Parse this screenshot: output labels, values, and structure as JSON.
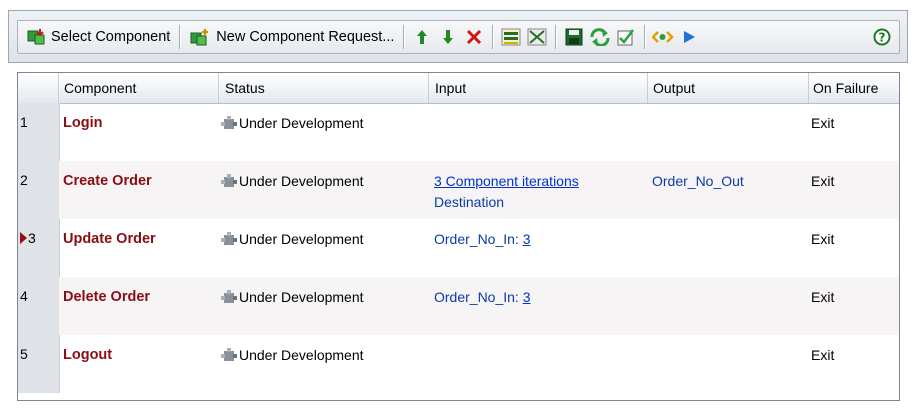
{
  "toolbar": {
    "select_component_label": "Select Component",
    "new_component_request_label": "New Component Request..."
  },
  "columns": [
    "Component",
    "Status",
    "Input",
    "Output",
    "On Failure"
  ],
  "rows": [
    {
      "num": "1",
      "component": "Login",
      "status": "Under Development",
      "input_link": "",
      "input_extra": "",
      "input_prefix": "",
      "input_value": "",
      "output": "",
      "on_failure": "Exit"
    },
    {
      "num": "2",
      "component": "Create Order",
      "status": "Under Development",
      "input_link": "3 Component iterations",
      "input_extra": "Destination",
      "input_prefix": "",
      "input_value": "",
      "output": "Order_No_Out",
      "on_failure": "Exit"
    },
    {
      "num": "3",
      "component": "Update Order",
      "status": "Under Development",
      "input_link": "",
      "input_extra": "",
      "input_prefix": "Order_No_In: ",
      "input_value": "3",
      "output": "",
      "on_failure": "Exit"
    },
    {
      "num": "4",
      "component": "Delete Order",
      "status": "Under Development",
      "input_link": "",
      "input_extra": "",
      "input_prefix": "Order_No_In: ",
      "input_value": "3",
      "output": "",
      "on_failure": "Exit"
    },
    {
      "num": "5",
      "component": "Logout",
      "status": "Under Development",
      "input_link": "",
      "input_extra": "",
      "input_prefix": "",
      "input_value": "",
      "output": "",
      "on_failure": "Exit"
    }
  ],
  "current_row_marker": "3",
  "colors": {
    "component_text": "#8b0d14",
    "link": "#0033cc",
    "row_alt": "#f7f4f5",
    "toolbar_bg": "#dfe3e8"
  },
  "icons": [
    "select-component-icon",
    "new-component-request-icon",
    "move-up-icon",
    "move-down-icon",
    "delete-icon",
    "expand-all-icon",
    "collapse-all-icon",
    "save-icon",
    "refresh-icon",
    "validate-icon",
    "data-icon",
    "run-icon",
    "help-icon",
    "component-status-icon",
    "current-row-arrow-icon"
  ]
}
